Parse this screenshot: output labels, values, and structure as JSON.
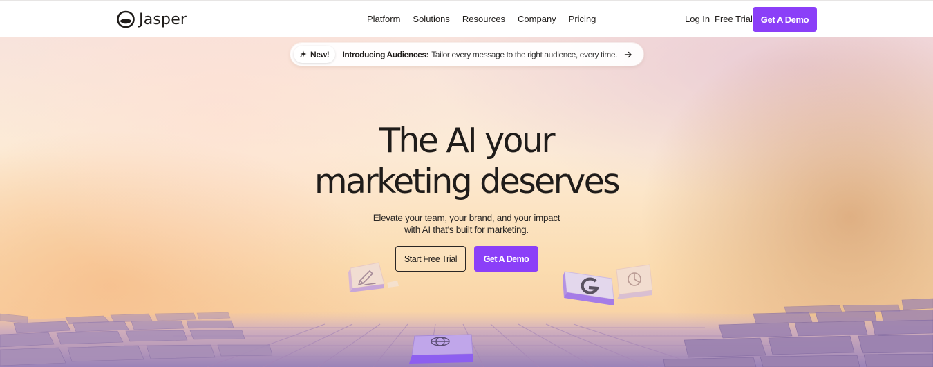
{
  "header": {
    "logo_text": "Jasper",
    "nav": [
      {
        "label": "Platform"
      },
      {
        "label": "Solutions"
      },
      {
        "label": "Resources"
      },
      {
        "label": "Company"
      },
      {
        "label": "Pricing"
      }
    ],
    "login_label": "Log In",
    "free_trial_label": "Free Trial",
    "demo_label": "Get A Demo"
  },
  "announcement": {
    "badge": "New!",
    "title": "Introducing Audiences:",
    "text": "Tailor every message to the right audience, every time."
  },
  "hero": {
    "headline_line1": "The AI your",
    "headline_line2": "marketing deserves",
    "subtext_line1": "Elevate your team, your brand, and your impact",
    "subtext_line2": "with AI that's built for marketing.",
    "primary_cta": "Start Free Trial",
    "secondary_cta": "Get A Demo"
  },
  "floating_tiles": [
    "pencil-icon",
    "google-g-icon",
    "pie-chart-icon",
    "globe-icon"
  ],
  "colors": {
    "accent": "#8b3ff8",
    "text": "#1f1c1a",
    "tile_purple": "#a57ce6"
  }
}
